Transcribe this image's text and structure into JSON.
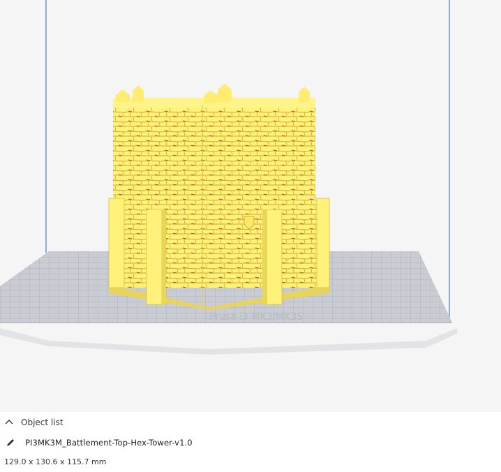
{
  "object_panel": {
    "list_label": "Object list",
    "object_name": "PI3MK3M_Battlement-Top-Hex-Tower-v1.0",
    "dimensions": "129.0 x 130.6 x 115.7 mm"
  },
  "bed_watermark": "Prusa i3 MK3/MK3S",
  "icons": {
    "collapse": "chevron-up-icon",
    "edit": "pencil-icon"
  },
  "colors": {
    "model": "#fff176",
    "build_volume_line": "#2a5fd0",
    "bed_surface": "#c9ccd2",
    "background": "#f5f5f5"
  }
}
